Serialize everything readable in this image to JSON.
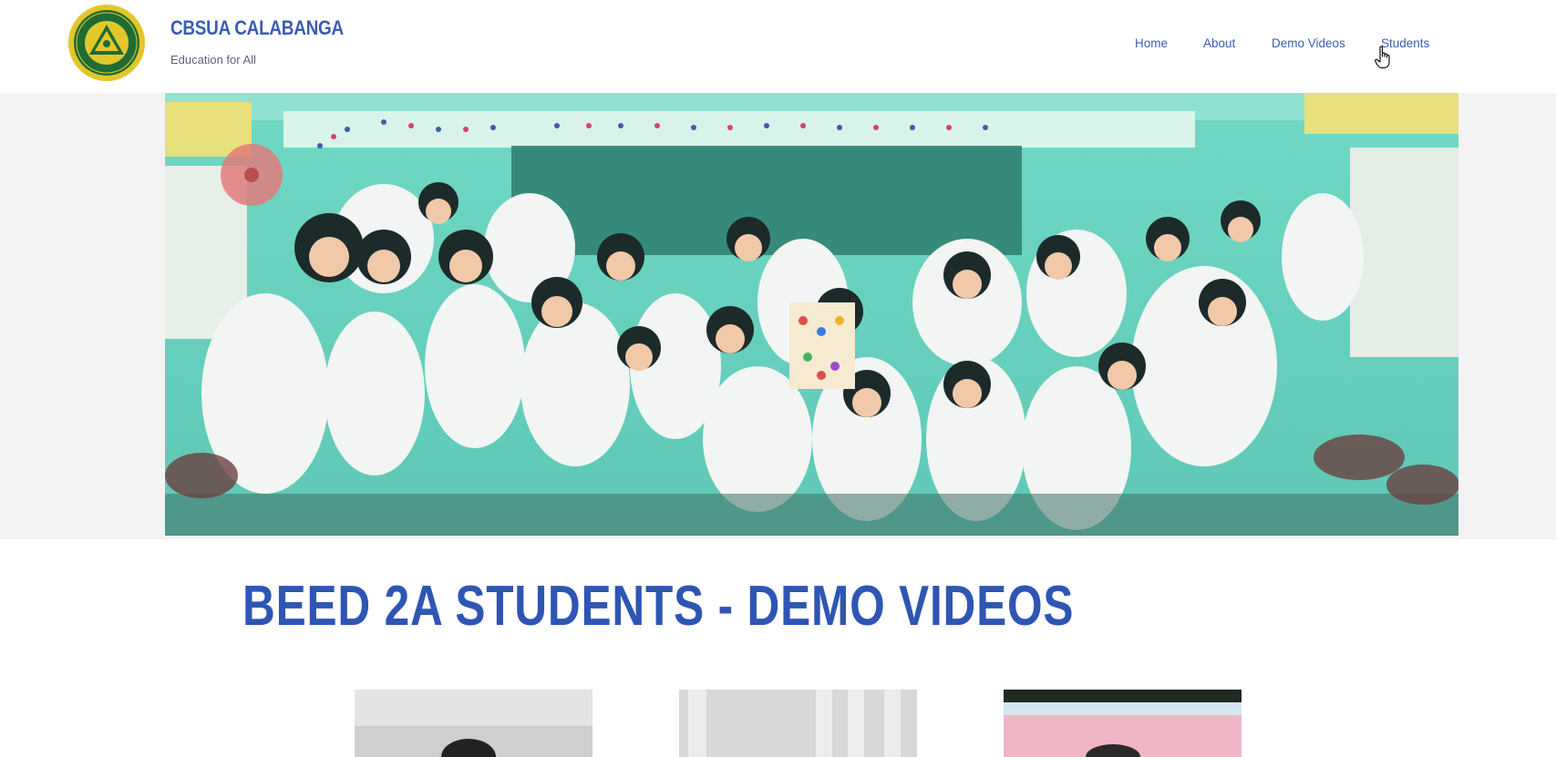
{
  "header": {
    "brand_title": "CBSUA CALABANGA",
    "brand_tagline": "Education for All"
  },
  "nav": {
    "items": [
      {
        "label": "Home"
      },
      {
        "label": "About"
      },
      {
        "label": "Demo Videos"
      },
      {
        "label": "Students"
      }
    ],
    "hovered": "Students"
  },
  "main": {
    "heading": "BEED 2A STUDENTS - DEMO VIDEOS"
  },
  "colors": {
    "brand": "#3a5cb3",
    "heading": "#2f55b4",
    "logo_gold": "#e3c72a",
    "logo_green": "#1f6b34"
  },
  "icons": {
    "logo": "university-seal-icon",
    "cursor": "hand-pointer-icon"
  }
}
